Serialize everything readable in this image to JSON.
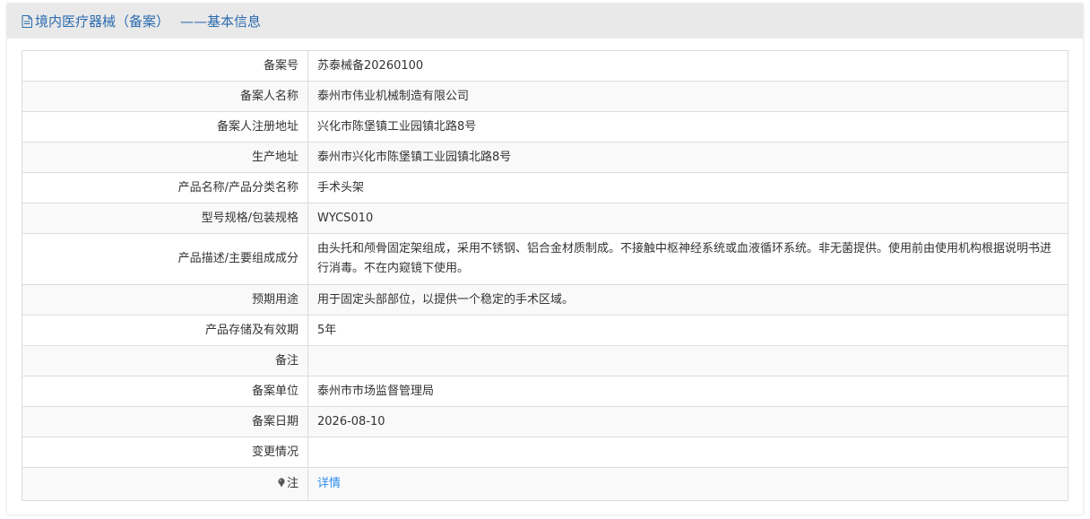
{
  "header": {
    "title": "境内医疗器械（备案）",
    "subtitle": "——基本信息",
    "icon": "document-icon"
  },
  "rows": [
    {
      "label": "备案号",
      "value": "苏泰械备20260100"
    },
    {
      "label": "备案人名称",
      "value": "泰州市伟业机械制造有限公司"
    },
    {
      "label": "备案人注册地址",
      "value": "兴化市陈堡镇工业园镇北路8号"
    },
    {
      "label": "生产地址",
      "value": "泰州市兴化市陈堡镇工业园镇北路8号"
    },
    {
      "label": "产品名称/产品分类名称",
      "value": "手术头架"
    },
    {
      "label": "型号规格/包装规格",
      "value": "WYCS010"
    },
    {
      "label": "产品描述/主要组成成分",
      "value": "由头托和颅骨固定架组成，采用不锈钢、铝合金材质制成。不接触中枢神经系统或血液循环系统。非无菌提供。使用前由使用机构根据说明书进行消毒。不在内窥镜下使用。"
    },
    {
      "label": "预期用途",
      "value": "用于固定头部部位，以提供一个稳定的手术区域。"
    },
    {
      "label": "产品存储及有效期",
      "value": "5年"
    },
    {
      "label": "备注",
      "value": ""
    },
    {
      "label": "备案单位",
      "value": "泰州市市场监督管理局"
    },
    {
      "label": "备案日期",
      "value": "2026-08-10"
    },
    {
      "label": "变更情况",
      "value": ""
    }
  ],
  "note": {
    "label": "注",
    "icon": "pin-icon",
    "link_text": "详情"
  },
  "colors": {
    "header_bg": "#e9e9e9",
    "title": "#2b6cb0",
    "link": "#2d8cf0"
  }
}
